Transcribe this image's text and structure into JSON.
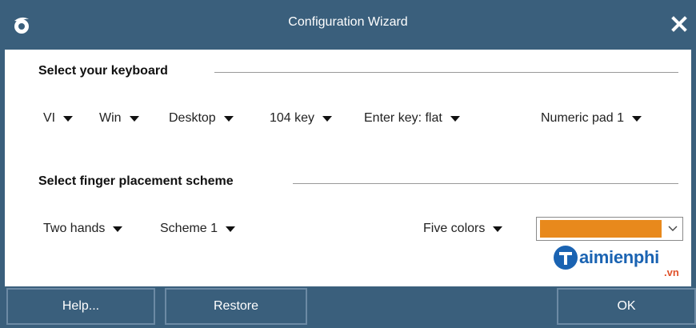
{
  "window": {
    "title": "Configuration Wizard",
    "logo_icon": "app-logo-icon",
    "close_icon": "close-icon"
  },
  "keyboard_section": {
    "title": "Select your keyboard",
    "dropdowns": [
      {
        "label": "VI"
      },
      {
        "label": "Win"
      },
      {
        "label": "Desktop"
      },
      {
        "label": "104 key"
      },
      {
        "label": "Enter key: flat"
      },
      {
        "label": "Numeric pad 1"
      }
    ]
  },
  "finger_section": {
    "title": "Select finger placement scheme",
    "dropdowns": [
      {
        "label": "Two hands"
      },
      {
        "label": "Scheme 1"
      },
      {
        "label": "Five colors"
      }
    ],
    "color_select": {
      "selected_color": "#e8891c",
      "chevron_icon": "chevron-down-icon"
    }
  },
  "watermark": {
    "text": "aimienphi",
    "sub": ".vn"
  },
  "footer": {
    "help_label": "Help...",
    "restore_label": "Restore",
    "ok_label": "OK"
  },
  "colors": {
    "chrome": "#3a5f7c",
    "button_border": "#6c8aa4",
    "swatch": "#e8891c"
  }
}
